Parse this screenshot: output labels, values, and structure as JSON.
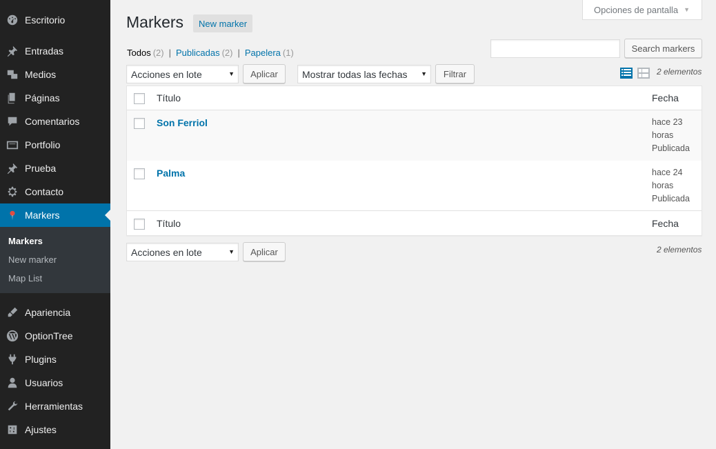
{
  "sidebar": {
    "items": [
      {
        "label": "Escritorio",
        "icon": "dashboard-icon"
      },
      {
        "label": "Entradas",
        "icon": "pin-icon"
      },
      {
        "label": "Medios",
        "icon": "media-icon"
      },
      {
        "label": "Páginas",
        "icon": "pages-icon"
      },
      {
        "label": "Comentarios",
        "icon": "comment-icon"
      },
      {
        "label": "Portfolio",
        "icon": "portfolio-icon"
      },
      {
        "label": "Prueba",
        "icon": "pin-icon"
      },
      {
        "label": "Contacto",
        "icon": "gear-icon"
      },
      {
        "label": "Markers",
        "icon": "map-marker-icon"
      },
      {
        "label": "Apariencia",
        "icon": "brush-icon"
      },
      {
        "label": "OptionTree",
        "icon": "wordpress-icon"
      },
      {
        "label": "Plugins",
        "icon": "plugin-icon"
      },
      {
        "label": "Usuarios",
        "icon": "user-icon"
      },
      {
        "label": "Herramientas",
        "icon": "wrench-icon"
      },
      {
        "label": "Ajustes",
        "icon": "settings-icon"
      }
    ],
    "submenu": [
      "Markers",
      "New marker",
      "Map List"
    ]
  },
  "header": {
    "screen_options": "Opciones de pantalla",
    "title": "Markers",
    "new_button": "New marker"
  },
  "filters": {
    "views": [
      {
        "label": "Todos",
        "count": "(2)"
      },
      {
        "label": "Publicadas",
        "count": "(2)"
      },
      {
        "label": "Papelera",
        "count": "(1)"
      }
    ],
    "separator": "|",
    "search_button": "Search markers",
    "bulk_actions": "Acciones en lote",
    "apply": "Aplicar",
    "date_filter": "Mostrar todas las fechas",
    "filter_button": "Filtrar",
    "item_count": "2 elementos"
  },
  "table": {
    "col_title": "Título",
    "col_date": "Fecha",
    "rows": [
      {
        "title": "Son Ferriol",
        "date_line1": "hace 23",
        "date_line2": "horas",
        "status": "Publicada"
      },
      {
        "title": "Palma",
        "date_line1": "hace 24",
        "date_line2": "horas",
        "status": "Publicada"
      }
    ]
  },
  "colors": {
    "accent": "#0073aa",
    "sidebar": "#222222",
    "submenu": "#32373c"
  }
}
